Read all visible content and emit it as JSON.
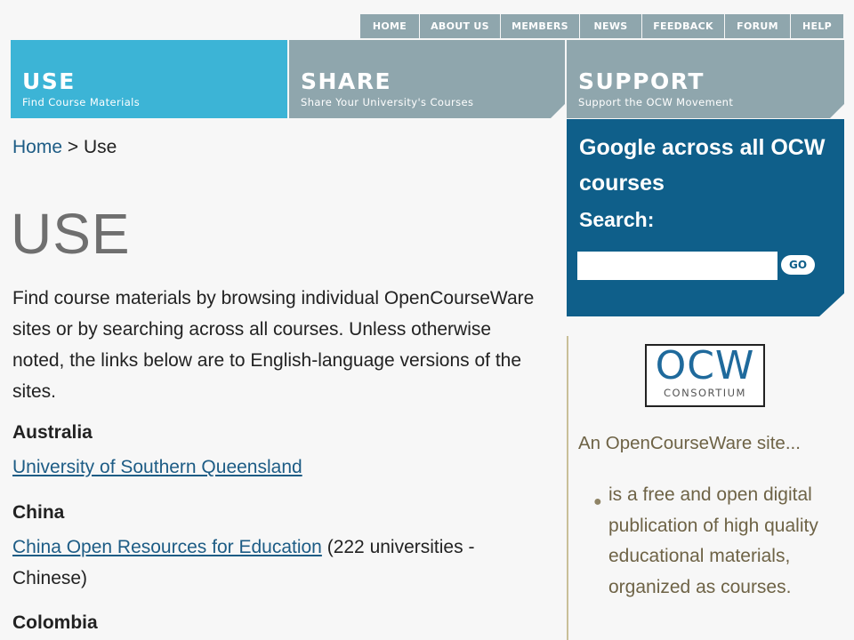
{
  "topnav": [
    "HOME",
    "ABOUT US",
    "MEMBERS",
    "NEWS",
    "FEEDBACK",
    "FORUM",
    "HELP"
  ],
  "tabs": [
    {
      "title": "USE",
      "subtitle": "Find Course Materials",
      "color": "#3cb4d6"
    },
    {
      "title": "SHARE",
      "subtitle": "Share Your University's Courses",
      "color": "#8fa6ad"
    },
    {
      "title": "SUPPORT",
      "subtitle": "Support the OCW Movement",
      "color": "#8fa6ad"
    }
  ],
  "breadcrumb": {
    "home": "Home",
    "separator": " > ",
    "current": "Use"
  },
  "page_title": "USE",
  "intro": "Find course materials by browsing individual OpenCourseWare sites or by searching across all courses. Unless otherwise noted, the links below are to English-language versions of the sites.",
  "countries": [
    {
      "name": "Australia",
      "link": "University of Southern Queensland",
      "note": ""
    },
    {
      "name": "China",
      "link": "China Open Resources for Education",
      "note": " (222 universities - Chinese)"
    },
    {
      "name": "Colombia"
    }
  ],
  "search": {
    "heading": "Google across all OCW courses",
    "label": "Search:",
    "value": "",
    "go": "GO"
  },
  "logo": {
    "big": "OCW",
    "small": "CONSORTIUM"
  },
  "sidebar": {
    "intro": "An OpenCourseWare site...",
    "bullets": [
      "is a free and open digital publication of high quality educational materials, organized as courses."
    ]
  },
  "colors": {
    "link": "#1d5c85",
    "search_bg": "#0f5f8a",
    "sidebar_text": "#6e6346"
  }
}
